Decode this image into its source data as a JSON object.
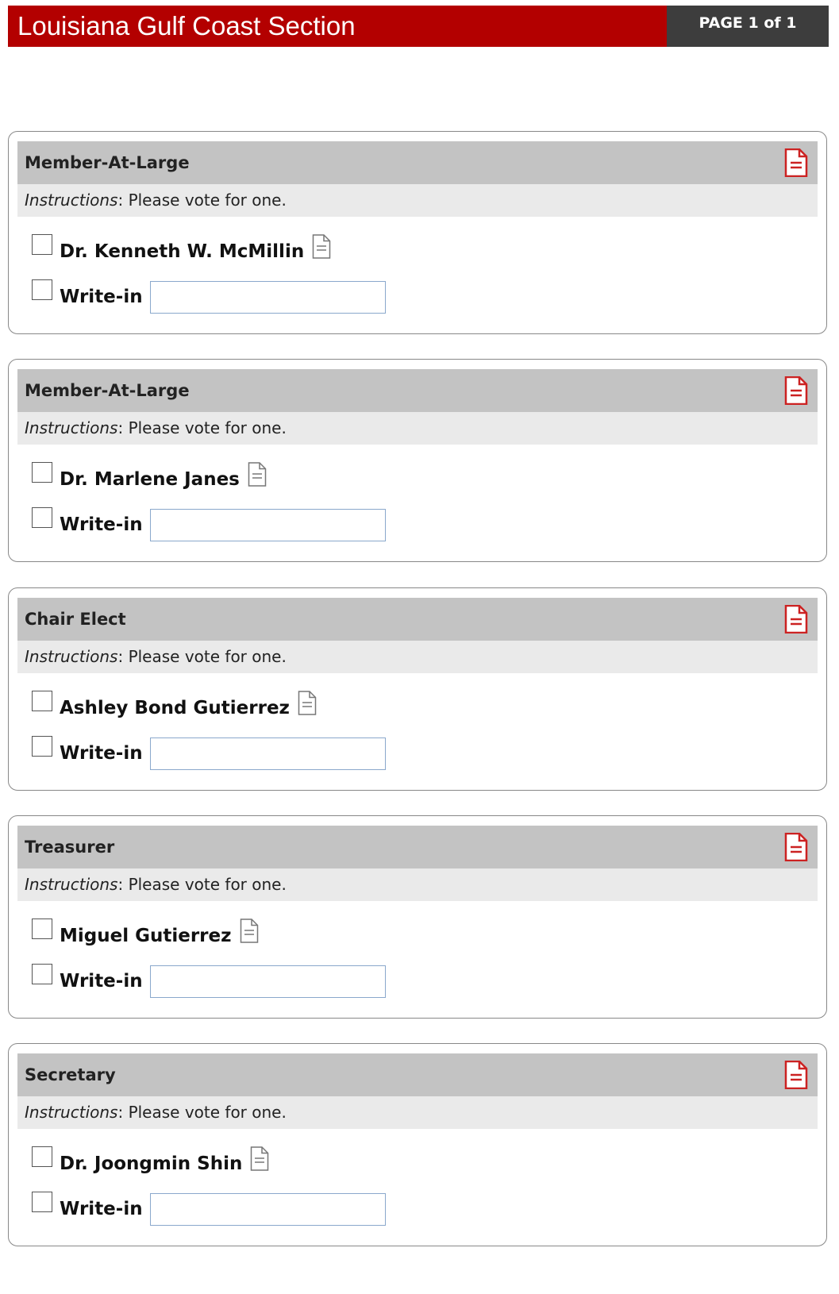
{
  "header": {
    "title": "Louisiana Gulf Coast Section",
    "page_indicator": "PAGE 1 of 1"
  },
  "instructions_label": "Instructions",
  "instructions_text": ": Please vote for one.",
  "write_in_label": "Write-in",
  "write_in_value": "",
  "icons": {
    "position_doc": "pdf-document-icon",
    "candidate_doc": "document-icon"
  },
  "colors": {
    "header_red": "#b30000",
    "header_dark": "#3d3d3d",
    "position_header_bg": "#c3c3c3",
    "instructions_bg": "#eaeaea",
    "pdf_icon_red": "#cc2222"
  },
  "ballots": [
    {
      "position": "Member-At-Large",
      "candidate": "Dr. Kenneth W. McMillin"
    },
    {
      "position": "Member-At-Large",
      "candidate": "Dr. Marlene Janes"
    },
    {
      "position": "Chair Elect",
      "candidate": "Ashley Bond Gutierrez"
    },
    {
      "position": "Treasurer",
      "candidate": "Miguel Gutierrez"
    },
    {
      "position": "Secretary",
      "candidate": "Dr. Joongmin Shin"
    }
  ]
}
